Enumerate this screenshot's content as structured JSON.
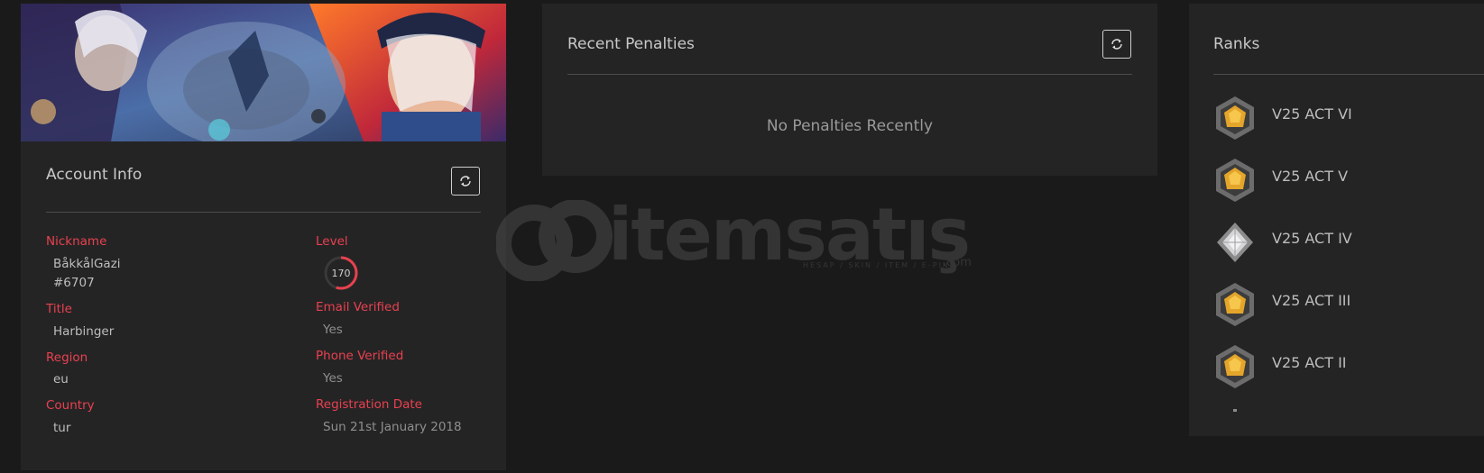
{
  "account": {
    "title": "Account Info",
    "fields": {
      "nickname": {
        "label": "Nickname",
        "value": "BåkkålGazi",
        "tag": "#6707"
      },
      "title": {
        "label": "Title",
        "value": "Harbinger"
      },
      "region": {
        "label": "Region",
        "value": "eu"
      },
      "country": {
        "label": "Country",
        "value": "tur"
      },
      "level": {
        "label": "Level",
        "value": "170",
        "progress": 0.55
      },
      "email_verified": {
        "label": "Email Verified",
        "value": "Yes"
      },
      "phone_verified": {
        "label": "Phone Verified",
        "value": "Yes"
      },
      "registration_date": {
        "label": "Registration Date",
        "value": "Sun 21st January 2018"
      }
    },
    "refresh_icon": "refresh-icon"
  },
  "penalties": {
    "title": "Recent Penalties",
    "empty_message": "No Penalties Recently",
    "refresh_icon": "refresh-icon"
  },
  "ranks": {
    "title": "Ranks",
    "items": [
      {
        "label": "V25 ACT VI",
        "tier": "gold"
      },
      {
        "label": "V25 ACT V",
        "tier": "gold"
      },
      {
        "label": "V25 ACT IV",
        "tier": "silver"
      },
      {
        "label": "V25 ACT III",
        "tier": "gold"
      },
      {
        "label": "V25 ACT II",
        "tier": "gold"
      }
    ]
  },
  "watermark": {
    "brand": "itemsatış",
    "tagline": "HESAP / SKIN / ITEM / E-PIN",
    "suffix": ".com"
  },
  "colors": {
    "accent": "#e8414f",
    "card": "#252425",
    "background": "#1b1a1b"
  }
}
